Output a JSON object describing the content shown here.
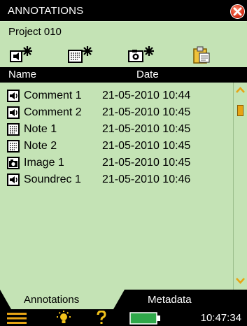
{
  "window": {
    "title": "ANNOTATIONS"
  },
  "project": {
    "name": "Project 010"
  },
  "toolbar": {
    "tools": [
      {
        "icon": "new-comment-icon"
      },
      {
        "icon": "new-note-icon"
      },
      {
        "icon": "new-image-icon"
      },
      {
        "icon": "paste-icon"
      }
    ]
  },
  "columns": {
    "name": "Name",
    "date": "Date"
  },
  "rows": [
    {
      "icon": "comment-icon",
      "name": "Comment 1",
      "date": "21-05-2010 10:44"
    },
    {
      "icon": "comment-icon",
      "name": "Comment 2",
      "date": "21-05-2010 10:45"
    },
    {
      "icon": "note-icon",
      "name": "Note 1",
      "date": "21-05-2010 10:45"
    },
    {
      "icon": "note-icon",
      "name": "Note 2",
      "date": "21-05-2010 10:45"
    },
    {
      "icon": "camera-icon",
      "name": "Image 1",
      "date": "21-05-2010 10:45"
    },
    {
      "icon": "comment-icon",
      "name": "Soundrec 1",
      "date": "21-05-2010 10:46"
    }
  ],
  "tabs": {
    "annotations": "Annotations",
    "metadata": "Metadata"
  },
  "status": {
    "time": "10:47:34"
  },
  "colors": {
    "panel": "#c4e3b5",
    "bar": "#000000",
    "accent": "#e7a415",
    "close": "#d8321a",
    "battery": "#2fa84a"
  }
}
